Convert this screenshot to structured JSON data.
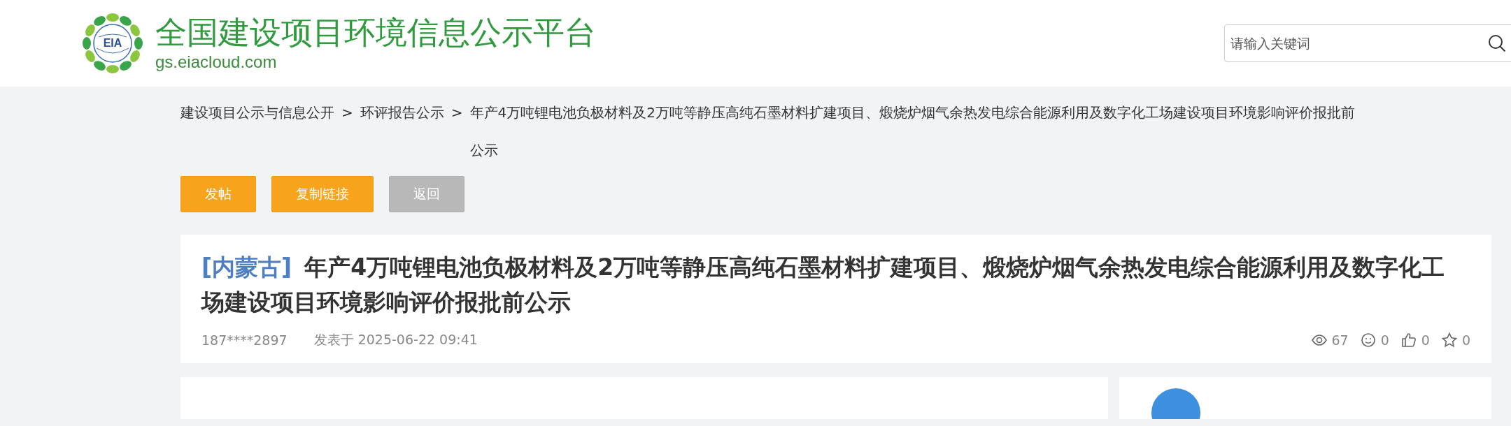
{
  "header": {
    "site_title": "全国建设项目环境信息公示平台",
    "domain": "gs.eiacloud.com",
    "logo_text": "EIA",
    "search": {
      "placeholder": "请输入关键词"
    }
  },
  "breadcrumb": [
    {
      "label": "建设项目公示与信息公开",
      "separator": ">"
    },
    {
      "label": "环评报告公示",
      "separator": ">"
    },
    {
      "label": "年产4万吨锂电池负极材料及2万吨等静压高纯石墨材料扩建项目、煅烧炉烟气余热发电综合能源利用及数字化工场建设项目环境影响评价报批前公示"
    }
  ],
  "buttons": [
    {
      "label": "发帖",
      "disabled": false
    },
    {
      "label": "复制链接",
      "disabled": false
    },
    {
      "label": "返回",
      "disabled": true
    }
  ],
  "post": {
    "region": "[内蒙古]",
    "title": "年产4万吨锂电池负极材料及2万吨等静压高纯石墨材料扩建项目、煅烧炉烟气余热发电综合能源利用及数字化工场建设项目环境影响评价报批前公示",
    "author": "187****2897",
    "posted": "发表于 2025-06-22 09:41",
    "stats": [
      {
        "kind": "views",
        "count": "67"
      },
      {
        "kind": "comments",
        "count": "0"
      },
      {
        "kind": "likes",
        "count": "0"
      },
      {
        "kind": "favorites",
        "count": "0"
      }
    ]
  }
}
